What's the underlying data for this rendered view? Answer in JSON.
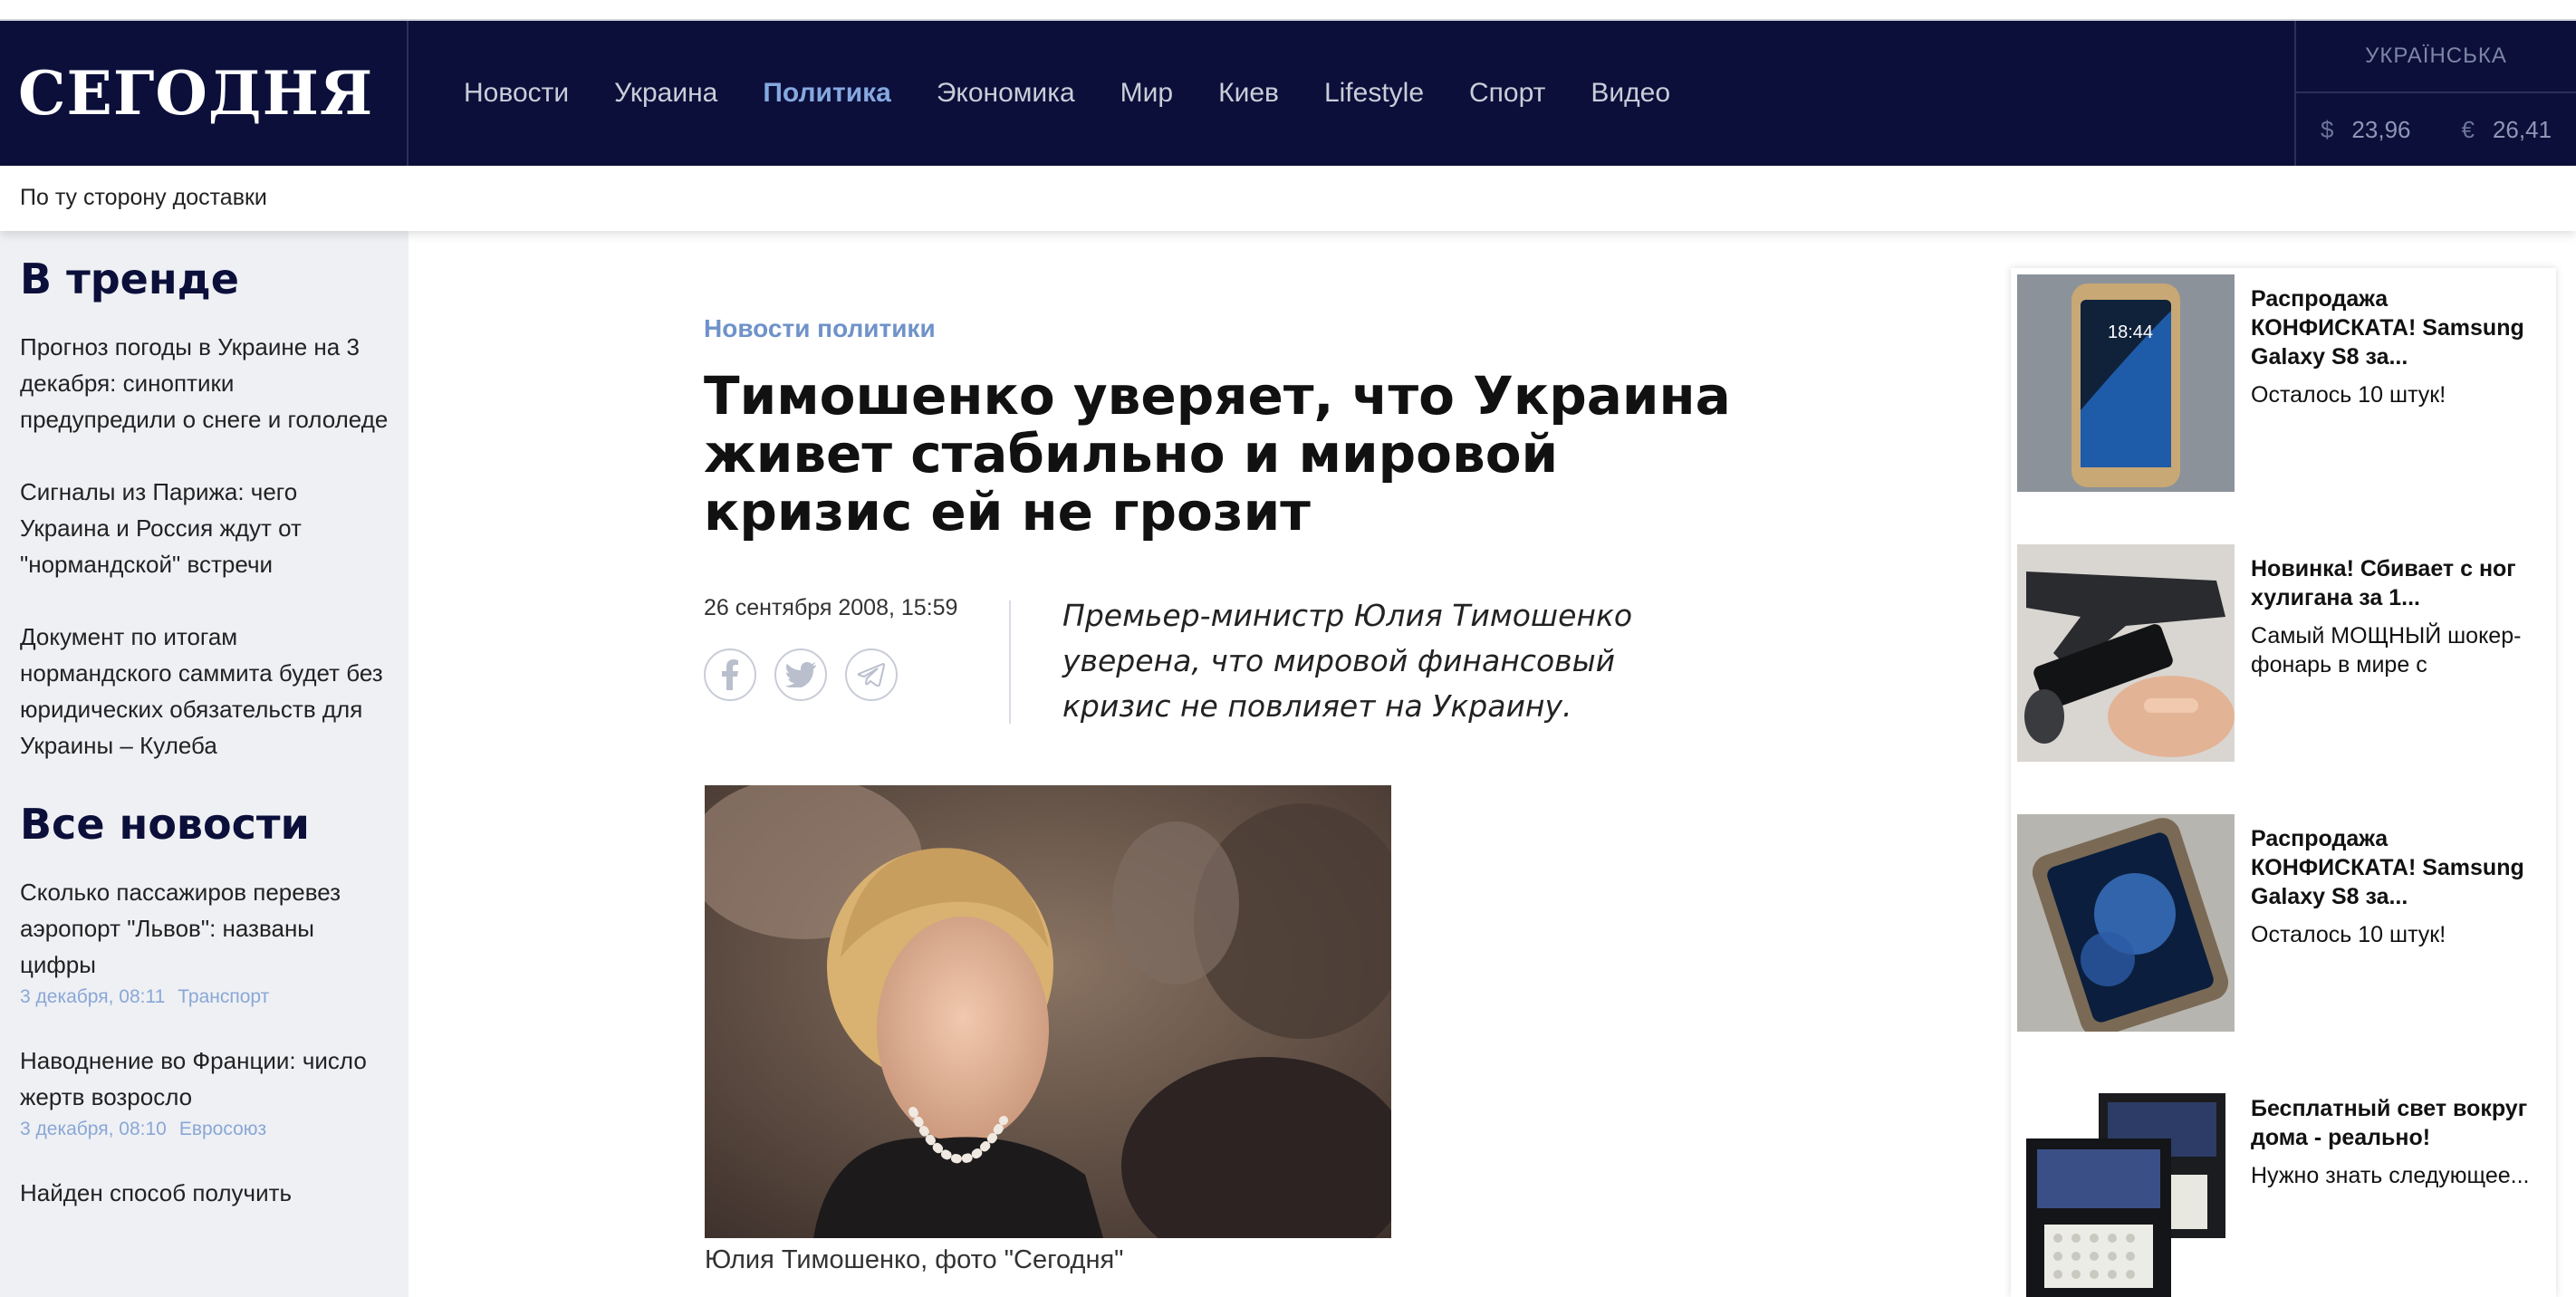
{
  "header": {
    "logo": "СЕГОДНЯ",
    "nav": [
      "Новости",
      "Украина",
      "Политика",
      "Экономика",
      "Мир",
      "Киев",
      "Lifestyle",
      "Спорт",
      "Видео"
    ],
    "active_nav": "Политика",
    "language": "УКРАЇНСЬКА",
    "usd_symbol": "$",
    "usd": "23,96",
    "eur_symbol": "€",
    "eur": "26,41"
  },
  "substrip": {
    "text": "По ту сторону доставки"
  },
  "sidebar": {
    "trend_title": "В тренде",
    "trend": [
      "Прогноз погоды в Украине на 3 декабря: синоптики предупредили о снеге и гололеде",
      "Сигналы из Парижа: чего Украина и Россия ждут от \"нормандской\" встречи",
      "Документ по итогам нормандского саммита будет без юридических обязательств для Украины – Кулеба"
    ],
    "all_title": "Все новости",
    "news": [
      {
        "title": "Сколько пассажиров перевез аэропорт \"Львов\": названы цифры",
        "date": "3 декабря, 08:11",
        "tag": "Транспорт"
      },
      {
        "title": "Наводнение во Франции: число жертв возросло",
        "date": "3 декабря, 08:10",
        "tag": "Евросоюз"
      },
      {
        "title": "Найден способ получить",
        "date": "",
        "tag": ""
      }
    ]
  },
  "article": {
    "category": "Новости политики",
    "headline": "Тимошенко уверяет, что Украина живет стабильно и мировой кризис ей не грозит",
    "date": "26 сентября 2008, 15:59",
    "lead": "Премьер-министр Юлия Тимошенко уверена, что мировой финансовый кризис не повлияет на Украину.",
    "caption": "Юлия Тимошенко, фото \"Сегодня\""
  },
  "ads": [
    {
      "title": "Распродажа КОНФИСКАТА! Samsung Galaxy S8 за...",
      "sub": "Осталось 10 штук!",
      "thumb_text": "18:44"
    },
    {
      "title": "Новинка! Сбивает с ног хулигана за 1...",
      "sub": "Самый МОЩНЫЙ шокер-фонарь в мире с"
    },
    {
      "title": "Распродажа КОНФИСКАТА! Samsung Galaxy S8 за...",
      "sub": "Осталось 10 штук!"
    },
    {
      "title": "Бесплатный свет вокруг дома - реально!",
      "sub": "Нужно знать следующее..."
    }
  ]
}
